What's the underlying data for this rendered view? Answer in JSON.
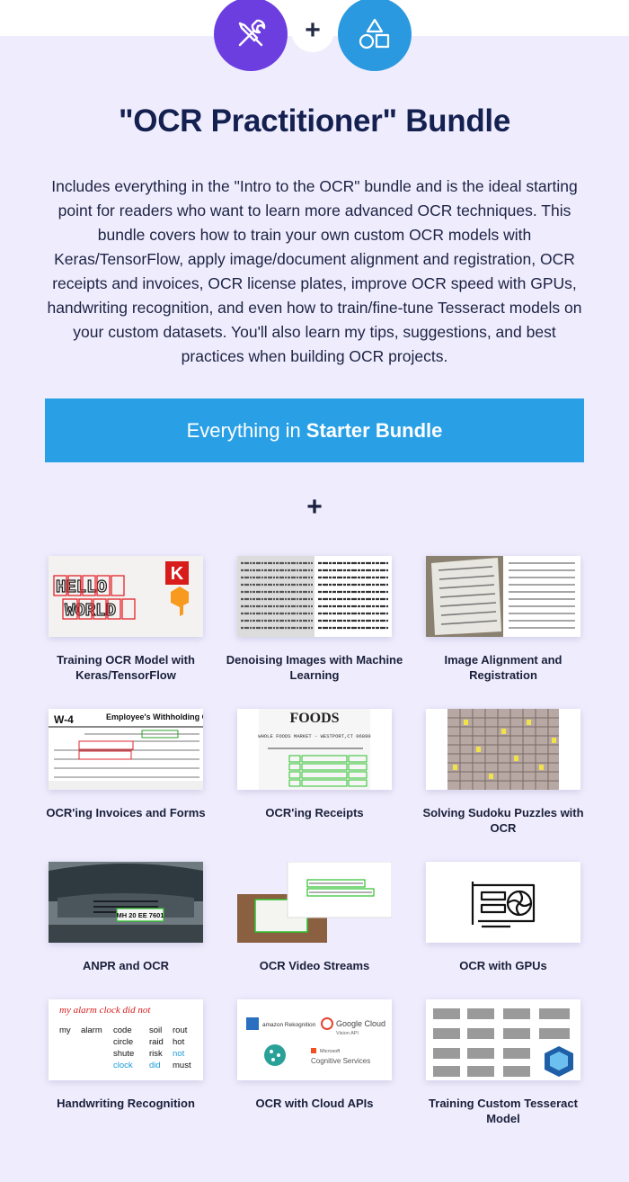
{
  "header": {
    "plus_symbol": "+"
  },
  "title": "\"OCR Practitioner\" Bundle",
  "description": "Includes everything in the \"Intro to the OCR\" bundle and is the ideal starting point for readers who want to learn more advanced OCR techniques. This bundle covers how to train your own custom OCR models with Keras/TensorFlow, apply image/document alignment and registration, OCR receipts and invoices, OCR license plates, improve OCR speed with GPUs, handwriting recognition, and even how to train/fine-tune Tesseract models on your custom datasets. You'll also learn my tips, suggestions, and best practices when building OCR projects.",
  "starter": {
    "prefix": "Everything in",
    "bold": "Starter Bundle"
  },
  "middle_plus": "+",
  "colors": {
    "panel": "#efedfd",
    "tools_circle": "#6c3ee0",
    "shapes_circle": "#2b99e0",
    "starter_bar": "#29a0e6",
    "title": "#142050"
  },
  "icons": [
    "tools-icon",
    "shapes-icon",
    "gpu-card-icon"
  ],
  "thumb_text": {
    "hello_rows": [
      "HELLO",
      "WORLD"
    ],
    "plate": "MH 20 EE 7601",
    "w4_form": "W-4",
    "w4_heading": "Employee's Withholding Cer",
    "foods_logo": "FOODS",
    "receipt_header": "WHOLE FOODS MARKET - WESTPORT,CT 06880",
    "keras_letter": "K",
    "handwriting_line": "my alarm clock did not",
    "handwriting_cols": [
      [
        "my"
      ],
      [
        "alarm"
      ],
      [
        "code",
        "circle",
        "shute",
        "clock"
      ],
      [
        "soil",
        "raid",
        "risk",
        "did"
      ],
      [
        "rout",
        "hot",
        "not",
        "must"
      ]
    ],
    "cloud_logos": [
      "amazon Rekognition",
      "Google Cloud",
      "Vision API",
      "Microsoft",
      "Cognitive Services"
    ]
  },
  "courses": [
    {
      "name": "Training OCR Model with Keras/TensorFlow"
    },
    {
      "name": "Denoising Images with Machine Learning"
    },
    {
      "name": "Image Alignment and Registration"
    },
    {
      "name": "OCR'ing Invoices and Forms"
    },
    {
      "name": "OCR'ing Receipts"
    },
    {
      "name": "Solving Sudoku Puzzles with OCR"
    },
    {
      "name": "ANPR and OCR"
    },
    {
      "name": "OCR Video Streams"
    },
    {
      "name": "OCR with GPUs"
    },
    {
      "name": "Handwriting Recognition"
    },
    {
      "name": "OCR with Cloud APIs"
    },
    {
      "name": "Training Custom Tesseract Model"
    }
  ]
}
